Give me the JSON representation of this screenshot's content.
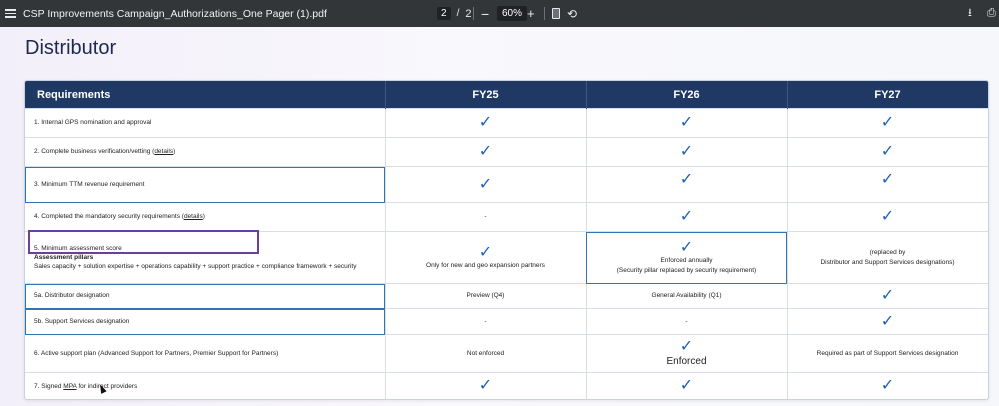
{
  "toolbar": {
    "title": "CSP Improvements Campaign_Authorizations_One Pager (1).pdf",
    "page_current": "2",
    "page_sep": "/",
    "page_total": "2",
    "zoom": "60%",
    "minus": "−",
    "plus": "+",
    "rotate": "⟲",
    "download": "⭳",
    "print": "⎙"
  },
  "page": {
    "heading": "Distributor",
    "table": {
      "headers": [
        "Requirements",
        "FY25",
        "FY26",
        "FY27"
      ],
      "check": "✓",
      "details_link": "details",
      "rows": [
        {
          "req": "1. Internal GPS nomination and approval",
          "fy25": "✓",
          "fy26": "✓",
          "fy27": "✓"
        },
        {
          "req_pre": "2. Complete business verification/vetting (",
          "req_link": "details",
          "req_post": ")",
          "fy25": "✓",
          "fy26": "✓",
          "fy27": "✓"
        },
        {
          "req": "3. Minimum TTM revenue requirement",
          "fy25": "✓",
          "fy26": "✓",
          "fy27": "✓"
        },
        {
          "req_pre": "4. Completed the mandatory security requirements (",
          "req_link": "details",
          "req_post": ")",
          "fy25": "-",
          "fy26": "✓",
          "fy27": "✓"
        },
        {
          "req": "5. Minimum assessment score",
          "req_bold": "Assessment pillars",
          "req_sub": "Sales capacity + solution expertise + operations capability + support practice + compliance framework + security",
          "fy25_note": "Only for new and geo expansion partners",
          "fy26_l1": "Enforced annually",
          "fy26_l2": "(Security pillar replaced by security requirement)",
          "fy27_l1": "(replaced by",
          "fy27_l2": "Distributor and Support Services designations)"
        },
        {
          "req": "5a. Distributor designation",
          "fy25": "Preview (Q4)",
          "fy26": "General Availability (Q1)",
          "fy27": "✓"
        },
        {
          "req": "5b. Support Services designation",
          "fy25": "-",
          "fy26": "-",
          "fy27": "✓"
        },
        {
          "req": "6. Active support plan (Advanced Support for Partners, Premier Support for Partners)",
          "fy25": "Not enforced",
          "fy26": "Enforced",
          "fy27": "Required as part of Support Services designation"
        },
        {
          "req_pre": "7. Signed ",
          "req_link": "MPA",
          "req_post": " for indirect providers",
          "fy25": "✓",
          "fy26": "✓",
          "fy27": "✓"
        }
      ]
    }
  }
}
